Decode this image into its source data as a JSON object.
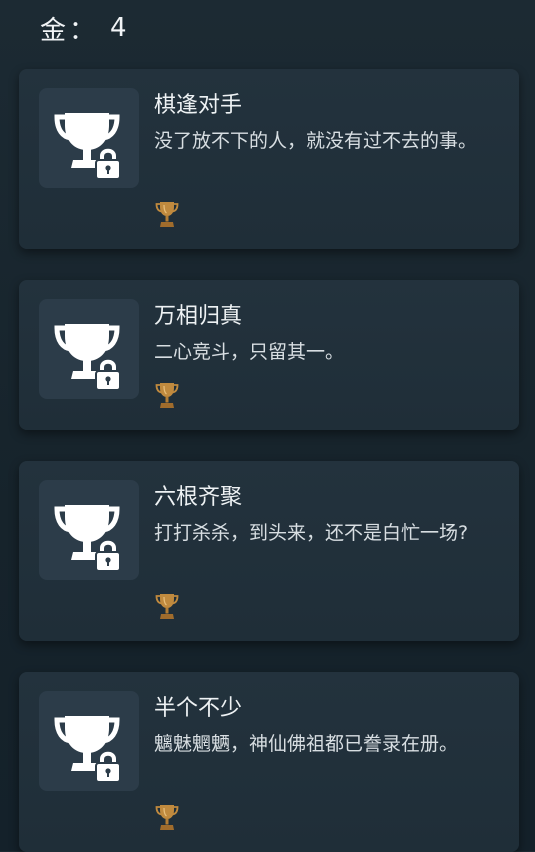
{
  "header": {
    "gold_label": "金",
    "separator": "：",
    "gold_count": "4"
  },
  "achievements": [
    {
      "title": "棋逢对手",
      "description": "没了放不下的人，就没有过不去的事。",
      "locked": true,
      "reward_icon": "bronze-trophy-icon"
    },
    {
      "title": "万相归真",
      "description": "二心竞斗，只留其一。",
      "locked": true,
      "reward_icon": "bronze-trophy-icon"
    },
    {
      "title": "六根齐聚",
      "description": "打打杀杀，到头来，还不是白忙一场?",
      "locked": true,
      "reward_icon": "bronze-trophy-icon"
    },
    {
      "title": "半个不少",
      "description": "魑魅魍魉，神仙佛祖都已誊录在册。",
      "locked": true,
      "reward_icon": "bronze-trophy-icon"
    }
  ],
  "colors": {
    "card_bg": "#23323d",
    "icon_bg": "#2c3c49",
    "bronze": "#c08a3e"
  }
}
